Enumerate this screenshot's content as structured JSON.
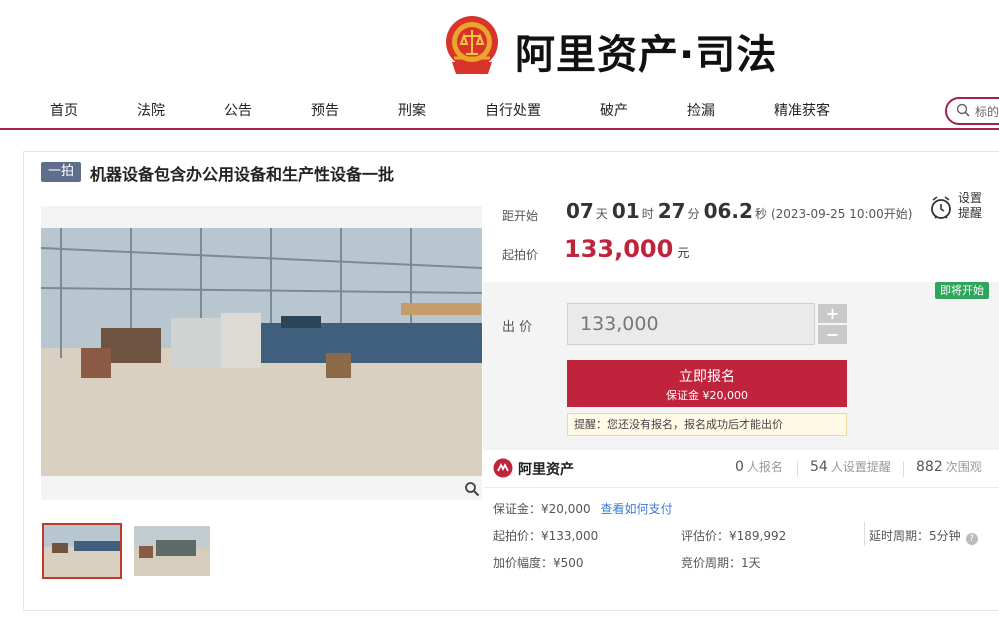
{
  "header": {
    "brand": "阿里资产·司法",
    "emblem": "court-emblem-icon"
  },
  "nav": {
    "items": [
      "首页",
      "法院",
      "公告",
      "预告",
      "刑案",
      "自行处置",
      "破产",
      "捡漏",
      "精准获客"
    ],
    "search_placeholder": "标的"
  },
  "lot": {
    "round_badge": "一拍",
    "title": "机器设备包含办公用设备和生产性设备一批"
  },
  "countdown": {
    "label": "距开始",
    "days": "07",
    "days_unit": "天",
    "hours": "01",
    "hours_unit": "时",
    "minutes": "27",
    "minutes_unit": "分",
    "seconds": "06.2",
    "seconds_unit": "秒",
    "start_time": "(2023-09-25 10:00开始)"
  },
  "reminder": {
    "line1": "设置",
    "line2": "提醒"
  },
  "start_price": {
    "label": "起拍价",
    "value": "133,000",
    "unit": "元"
  },
  "bid": {
    "status_badge": "即将开始",
    "label": "出 价",
    "input_value": "133,000",
    "plus": "+",
    "minus": "−",
    "signup_label": "立即报名",
    "deposit_line": "保证金 ¥20,000",
    "tip": "提醒：您还没有报名，报名成功后才能出价"
  },
  "stats": {
    "platform": "阿里资产",
    "signups": "0",
    "signups_unit": "人报名",
    "reminders": "54",
    "reminders_unit": "人设置提醒",
    "views": "882",
    "views_unit": "次围观"
  },
  "details": {
    "deposit": "保证金：¥20,000",
    "deposit_link": "查看如何支付",
    "start_price": "起拍价：¥133,000",
    "increment": "加价幅度：¥500",
    "valuation": "评估价：¥189,992",
    "bid_cycle": "竞价周期：1天",
    "delay_cycle": "延时周期：5分钟"
  },
  "colors": {
    "accent": "#a3224f",
    "price": "#c0243c",
    "badge": "#5e6e8c",
    "soon": "#2fa55c"
  }
}
